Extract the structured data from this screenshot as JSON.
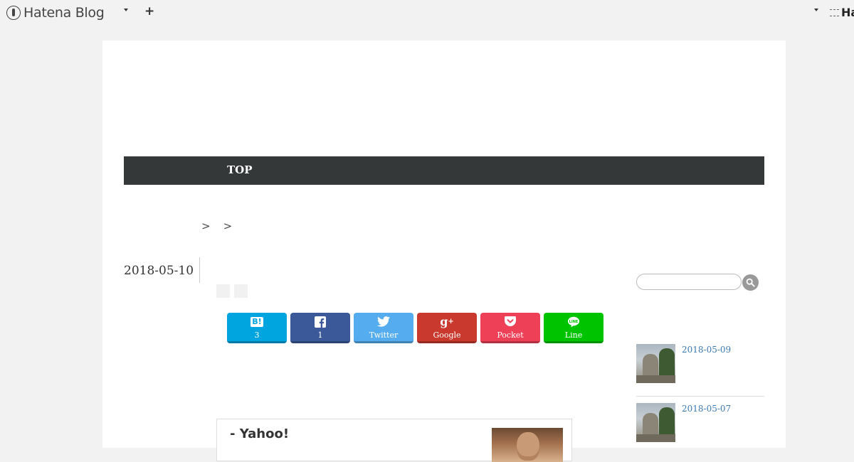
{
  "topbar": {
    "logo_text": "Hatena Blog",
    "add_label": "+",
    "right_text": "Ha"
  },
  "nav": {
    "items": [
      {
        "label": "TOP"
      }
    ]
  },
  "breadcrumb": {
    "separators": [
      ">",
      ">"
    ]
  },
  "entry": {
    "date": "2018-05-10",
    "share_buttons": [
      {
        "service": "hatena-bookmark",
        "icon": "hatena-b-icon",
        "label": "3",
        "color": "#00a4de"
      },
      {
        "service": "facebook",
        "icon": "facebook-icon",
        "label": "1",
        "color": "#3b5998"
      },
      {
        "service": "twitter",
        "icon": "twitter-icon",
        "label": "Twitter",
        "color": "#55acee"
      },
      {
        "service": "google-plus",
        "icon": "google-plus-icon",
        "label": "Google",
        "color": "#c9392d"
      },
      {
        "service": "pocket",
        "icon": "pocket-icon",
        "label": "Pocket",
        "color": "#ee4056"
      },
      {
        "service": "line",
        "icon": "line-icon",
        "label": "Line",
        "color": "#00c300"
      }
    ],
    "embed": {
      "title": "- Yahoo!",
      "subtitle": ""
    }
  },
  "sidebar": {
    "search_placeholder": "",
    "recent": [
      {
        "date": "2018-05-09"
      },
      {
        "date": "2018-05-07"
      }
    ]
  }
}
